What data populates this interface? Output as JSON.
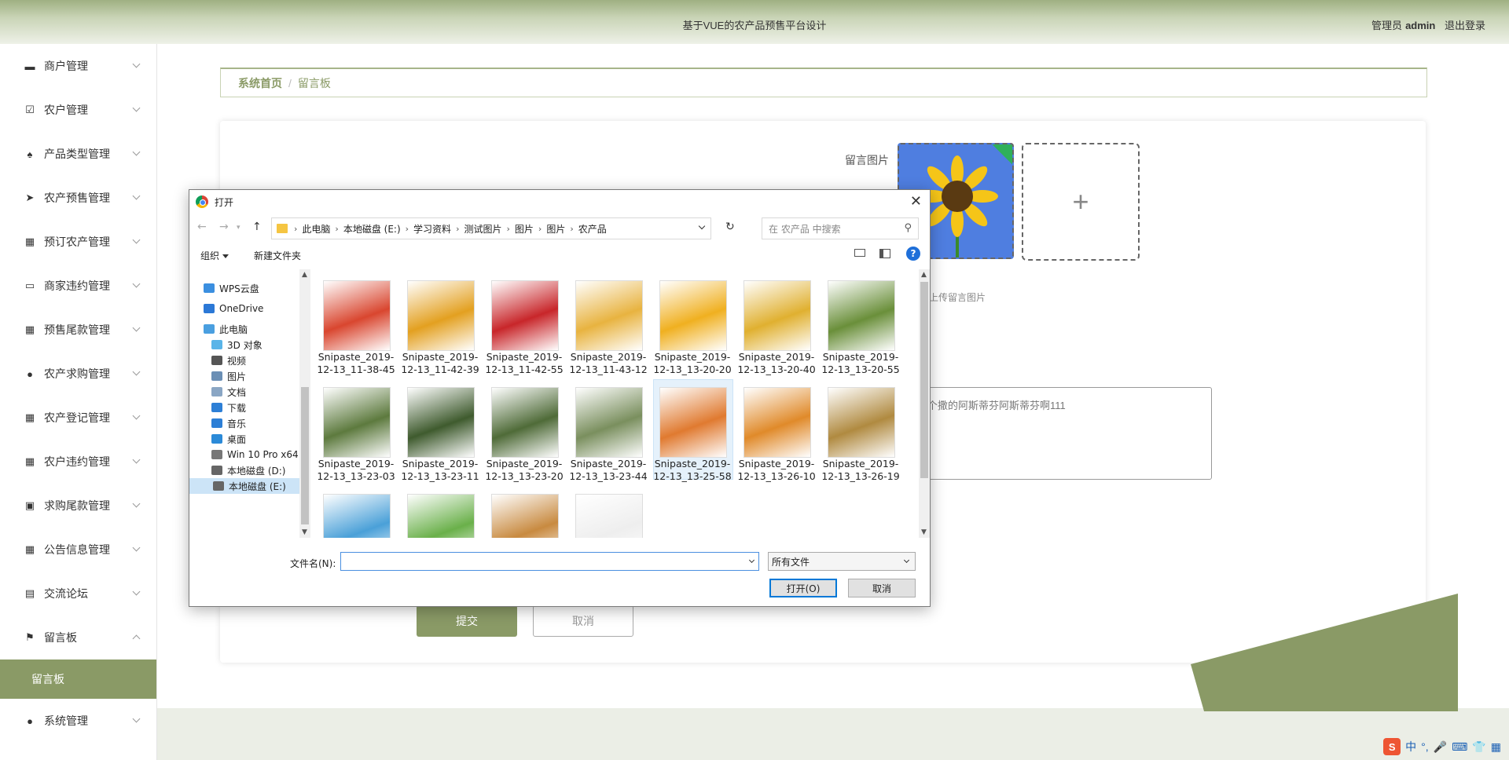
{
  "header": {
    "title": "基于VUE的农产品预售平台设计",
    "user_label": "管理员",
    "user_name": "admin",
    "logout": "退出登录"
  },
  "sidebar": {
    "items": [
      {
        "label": "商户管理",
        "icon": "briefcase-icon"
      },
      {
        "label": "农户管理",
        "icon": "clipboard-check-icon"
      },
      {
        "label": "产品类型管理",
        "icon": "leaf-icon"
      },
      {
        "label": "农产预售管理",
        "icon": "send-icon"
      },
      {
        "label": "预订农产管理",
        "icon": "grid-icon"
      },
      {
        "label": "商家违约管理",
        "icon": "monitor-icon"
      },
      {
        "label": "预售尾款管理",
        "icon": "grid-icon"
      },
      {
        "label": "农产求购管理",
        "icon": "user-icon"
      },
      {
        "label": "农产登记管理",
        "icon": "grid-icon"
      },
      {
        "label": "农户违约管理",
        "icon": "grid-icon"
      },
      {
        "label": "求购尾款管理",
        "icon": "wallet-icon"
      },
      {
        "label": "公告信息管理",
        "icon": "grid-icon"
      },
      {
        "label": "交流论坛",
        "icon": "chat-icon"
      },
      {
        "label": "留言板",
        "icon": "flag-icon"
      }
    ],
    "active_sub": "留言板",
    "last_item": {
      "label": "系统管理",
      "icon": "user-icon"
    }
  },
  "breadcrumb": {
    "home": "系统首页",
    "current": "留言板"
  },
  "form": {
    "image_label": "留言图片",
    "upload_hint": "请上传留言图片",
    "upload_plus": "+",
    "content_text": "个十多个撒的阿斯蒂芬阿斯蒂芬啊111",
    "submit": "提交",
    "cancel": "取消"
  },
  "colors": {
    "accent": "#8a9a66",
    "dialog_primary": "#0078d7"
  },
  "dialog": {
    "title": "打开",
    "path": [
      "此电脑",
      "本地磁盘 (E:)",
      "学习资料",
      "测试图片",
      "图片",
      "图片",
      "农产品"
    ],
    "search_placeholder": "在 农产品 中搜索",
    "organize": "组织",
    "new_folder": "新建文件夹",
    "help": "?",
    "nav_items": [
      {
        "label": "WPS云盘",
        "color": "#3b8fe0"
      },
      {
        "label": "OneDrive",
        "color": "#2b78d6"
      },
      {
        "label": "此电脑",
        "color": "#4a9fe0"
      },
      {
        "label": "3D 对象",
        "color": "#59b4e8"
      },
      {
        "label": "视频",
        "color": "#555555"
      },
      {
        "label": "图片",
        "color": "#6b8fb5"
      },
      {
        "label": "文档",
        "color": "#8aa6c4"
      },
      {
        "label": "下载",
        "color": "#2d7fd6"
      },
      {
        "label": "音乐",
        "color": "#2d7fd6"
      },
      {
        "label": "桌面",
        "color": "#2b8ad8"
      },
      {
        "label": "Win 10 Pro x64",
        "color": "#777777"
      },
      {
        "label": "本地磁盘 (D:)",
        "color": "#666666"
      },
      {
        "label": "本地磁盘 (E:)",
        "color": "#666666"
      }
    ],
    "files": [
      {
        "line1": "Snipaste_2019-",
        "line2": "12-13_11-38-45",
        "color": "#d9462f"
      },
      {
        "line1": "Snipaste_2019-",
        "line2": "12-13_11-42-39",
        "color": "#e3a020"
      },
      {
        "line1": "Snipaste_2019-",
        "line2": "12-13_11-42-55",
        "color": "#c8262a"
      },
      {
        "line1": "Snipaste_2019-",
        "line2": "12-13_11-43-12",
        "color": "#e8b340"
      },
      {
        "line1": "Snipaste_2019-",
        "line2": "12-13_13-20-20",
        "color": "#f0b020"
      },
      {
        "line1": "Snipaste_2019-",
        "line2": "12-13_13-20-40",
        "color": "#e0b030"
      },
      {
        "line1": "Snipaste_2019-",
        "line2": "12-13_13-20-55",
        "color": "#6a8f3a"
      },
      {
        "line1": "Snipaste_2019-",
        "line2": "12-13_13-23-03",
        "color": "#5d7a3e"
      },
      {
        "line1": "Snipaste_2019-",
        "line2": "12-13_13-23-11",
        "color": "#3f5b2e"
      },
      {
        "line1": "Snipaste_2019-",
        "line2": "12-13_13-23-20",
        "color": "#4f6b38"
      },
      {
        "line1": "Snipaste_2019-",
        "line2": "12-13_13-23-44",
        "color": "#7a8f5e"
      },
      {
        "line1": "Snipaste_2019-",
        "line2": "12-13_13-25-58",
        "color": "#e07a30"
      },
      {
        "line1": "Snipaste_2019-",
        "line2": "12-13_13-26-10",
        "color": "#e08a2a"
      },
      {
        "line1": "Snipaste_2019-",
        "line2": "12-13_13-26-19",
        "color": "#b08a40"
      },
      {
        "line1": "",
        "line2": "",
        "color": "#4aa0d8"
      },
      {
        "line1": "",
        "line2": "",
        "color": "#6ab04a"
      },
      {
        "line1": "",
        "line2": "",
        "color": "#c88a40"
      },
      {
        "line1": "",
        "line2": "",
        "color": "#eeeeee"
      }
    ],
    "selected_index": 11,
    "filename_label": "文件名(N):",
    "filename_value": "",
    "filetype": "所有文件",
    "open": "打开(O)",
    "cancel": "取消"
  },
  "tray": {
    "ime": "中",
    "logo": "S"
  }
}
